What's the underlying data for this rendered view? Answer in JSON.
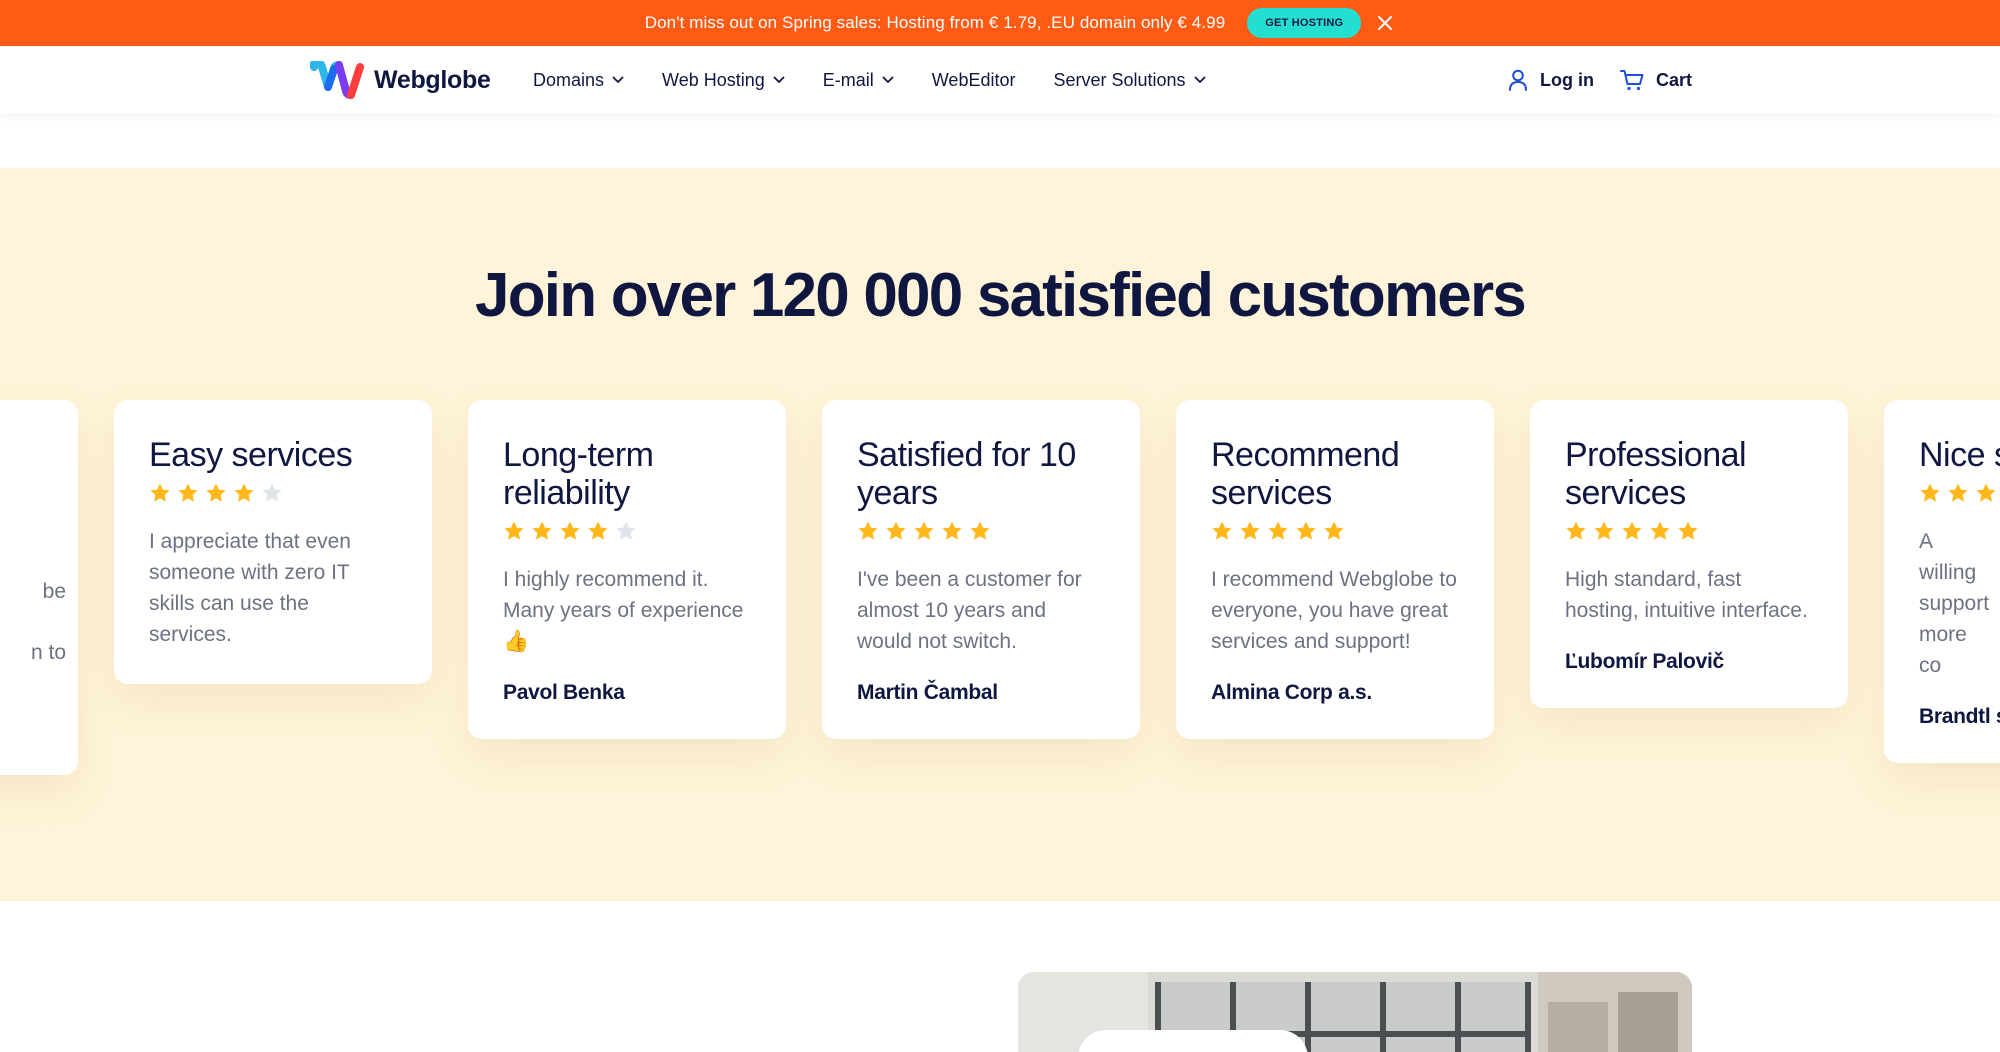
{
  "promo": {
    "text": "Don't miss out on Spring sales: Hosting from € 1.79, .EU domain only € 4.99",
    "button_label": "GET HOSTING",
    "close_icon": "close-icon"
  },
  "header": {
    "logo_text": "Webglobe",
    "nav": [
      {
        "label": "Domains",
        "has_dropdown": true
      },
      {
        "label": "Web Hosting",
        "has_dropdown": true
      },
      {
        "label": "E-mail",
        "has_dropdown": true
      },
      {
        "label": "WebEditor",
        "has_dropdown": false
      },
      {
        "label": "Server Solutions",
        "has_dropdown": true
      }
    ],
    "login_label": "Log in",
    "cart_label": "Cart"
  },
  "testimonials": {
    "title": "Join over 120 000 satisfied customers",
    "partial_left_lines": [
      "be",
      "n to"
    ],
    "cards": [
      {
        "title": "Easy services",
        "rating": 4,
        "text": "I appreciate that even someone with zero IT skills can use the services.",
        "author": ""
      },
      {
        "title": "Long-term reliability",
        "rating": 4,
        "text": "I highly recommend it. Many years of experience 👍",
        "author": "Pavol Benka"
      },
      {
        "title": "Satisfied for 10 years",
        "rating": 5,
        "text": "I've been a customer for almost 10 years and would not switch.",
        "author": "Martin Čambal"
      },
      {
        "title": "Recommend services",
        "rating": 5,
        "text": "I recommend Webglobe to everyone, you have great services and support!",
        "author": "Almina Corp a.s."
      },
      {
        "title": "Professional services",
        "rating": 5,
        "text": "High standard, fast hosting, intuitive interface.",
        "author": "Ľubomír Palovič"
      },
      {
        "title": "Nice s",
        "rating": 5,
        "text": "A willing support more co",
        "author": "Brandtl s"
      }
    ]
  },
  "colors": {
    "promo_bg": "#ff5b14",
    "promo_button": "#25ded2",
    "section_bg": "#fff4d9",
    "star_filled": "#ffb81c",
    "star_empty": "#dfe3ea",
    "text_dark": "#0f1740"
  }
}
